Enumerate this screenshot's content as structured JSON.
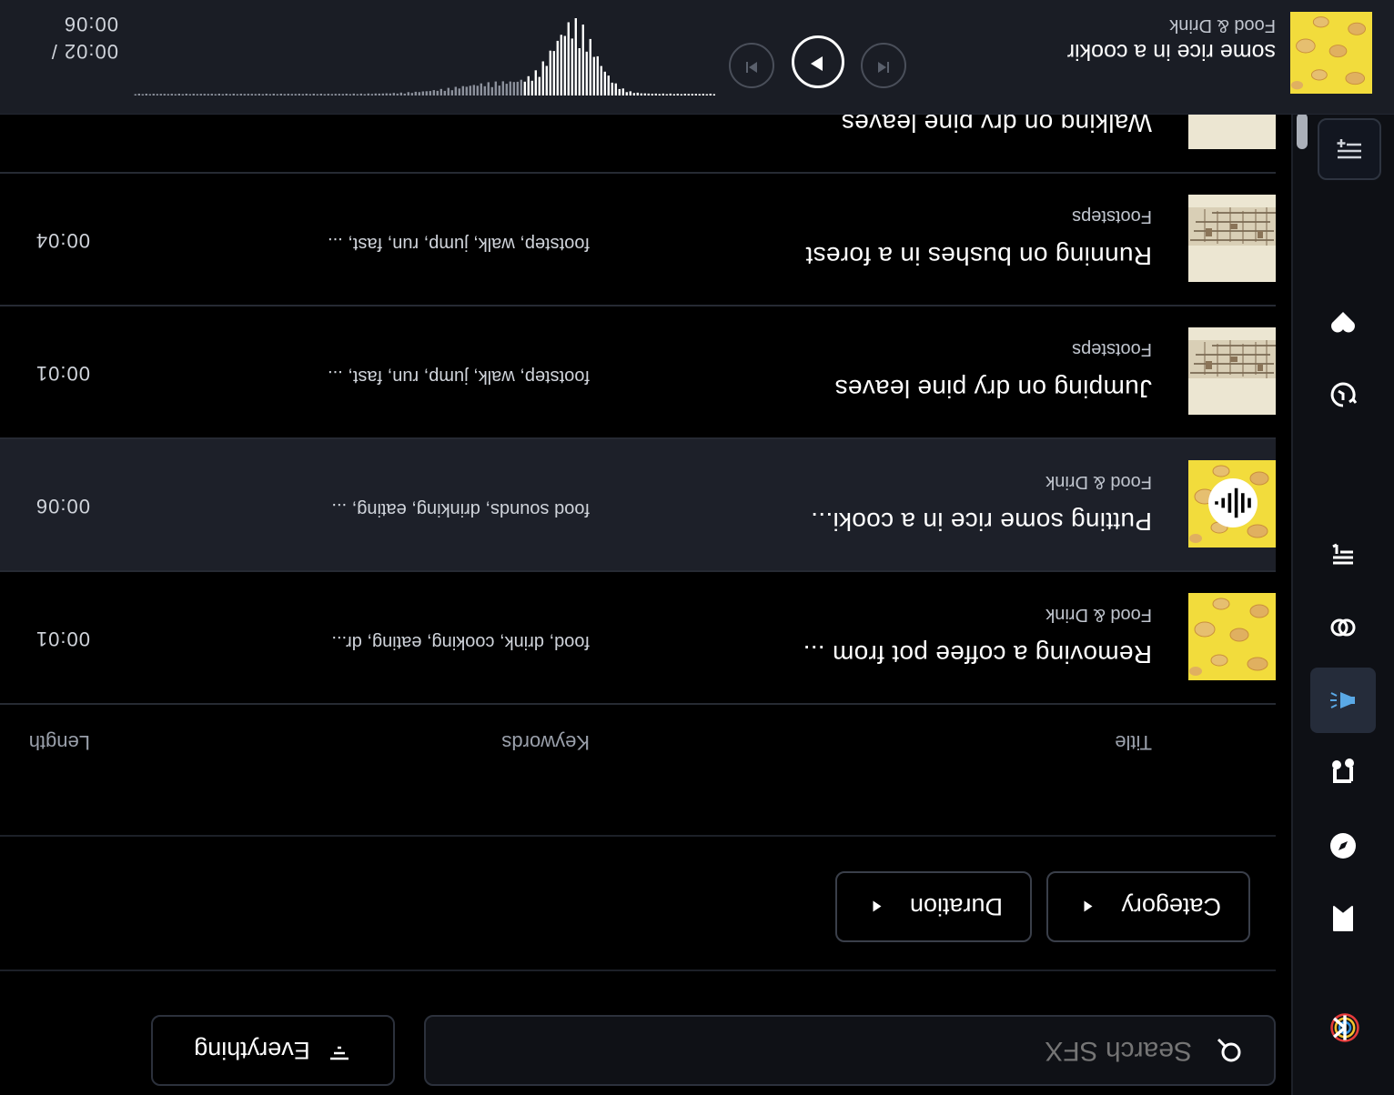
{
  "search": {
    "placeholder": "Search SFX",
    "scope_label": "Everything"
  },
  "filters": [
    {
      "label": "Category"
    },
    {
      "label": "Duration"
    }
  ],
  "table": {
    "headers": {
      "title": "Title",
      "keywords": "Keywords",
      "length": "Length"
    },
    "rows": [
      {
        "title": "Removing a coffee pot from ...",
        "category": "Food & Drink",
        "keywords": "food, drink, cooking, eating, dr...",
        "length": "00:01",
        "thumb": "food-drink",
        "playing": false
      },
      {
        "title": "Putting some rice in a cooki...",
        "category": "Food & Drink",
        "keywords": "food sounds, drinking, eating, ...",
        "length": "00:06",
        "thumb": "food-drink",
        "playing": true
      },
      {
        "title": "Jumping on dry pine leaves",
        "category": "Footsteps",
        "keywords": "footstep, walk, jump, run, fast, ...",
        "length": "00:01",
        "thumb": "footsteps",
        "playing": false
      },
      {
        "title": "Running on bushes in a forest",
        "category": "Footsteps",
        "keywords": "footstep, walk, jump, run, fast, ...",
        "length": "00:04",
        "thumb": "footsteps",
        "playing": false
      },
      {
        "title": "Walking on dry pine leaves",
        "category": "",
        "keywords": "",
        "length": "",
        "thumb": "footsteps",
        "playing": false
      }
    ]
  },
  "player": {
    "title": "some rice in a cookir",
    "category": "Food & Drink",
    "time_elapsed": "00:02 /",
    "time_total": "00:06",
    "progress": 0.33
  },
  "sidebar": {
    "items": [
      "logo-icon",
      "bookmark-icon",
      "compass-icon",
      "music-note-icon",
      "megaphone-icon",
      "link-icon",
      "playlist-icon",
      "history-icon",
      "heart-icon",
      "add-list-icon"
    ]
  },
  "colors": {
    "background": "#000000",
    "surface": "#1a1d25",
    "accent_yellow": "#f2dc3c"
  }
}
